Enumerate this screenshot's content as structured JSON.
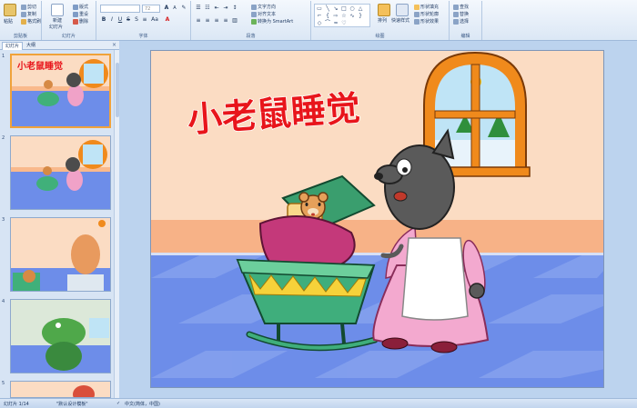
{
  "ribbon": {
    "clipboard": {
      "label": "剪贴板",
      "paste": "粘贴",
      "cut": "剪切",
      "copy": "复制",
      "format_painter": "格式刷"
    },
    "slides": {
      "label": "幻灯片",
      "new_slide": "新建",
      "new_slide2": "幻灯片",
      "layout": "版式",
      "reset": "重设",
      "delete": "删除"
    },
    "font": {
      "label": "字体",
      "font_size": "72"
    },
    "paragraph": {
      "label": "段落",
      "text_direction": "文字方向",
      "align_text": "对齐文本",
      "smartart": "转换为 SmartArt"
    },
    "drawing": {
      "label": "绘图",
      "arrange": "排列",
      "quick_styles": "快速样式",
      "shape_fill": "形状填充",
      "shape_outline": "形状轮廓",
      "shape_effects": "形状效果"
    },
    "editing": {
      "label": "编辑",
      "find": "查找",
      "replace": "替换",
      "select": "选择"
    }
  },
  "left_panel": {
    "tabs": [
      "幻灯片",
      "大纲"
    ],
    "close": "×",
    "thumbnails": [
      {
        "number": "1",
        "title": "小老鼠睡觉"
      },
      {
        "number": "2"
      },
      {
        "number": "3"
      },
      {
        "number": "4"
      },
      {
        "number": "5"
      }
    ]
  },
  "slide": {
    "title": "小老鼠睡觉",
    "colors": {
      "wall": "#fbdcc3",
      "floor": "#6d8de9",
      "title": "#e8151b",
      "window_frame": "#f08a1c"
    }
  },
  "status": {
    "slide_counter": "幻灯片 1/14",
    "theme": "\"默认设计模板\"",
    "language": "中文(简体，中国)"
  }
}
